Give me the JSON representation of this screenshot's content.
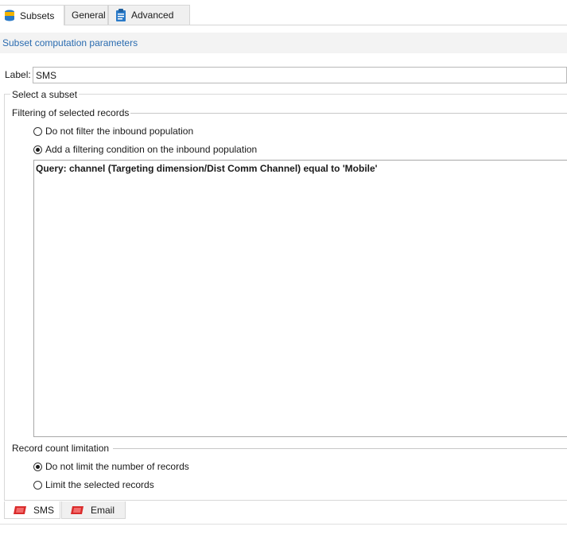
{
  "tabs": [
    {
      "label": "Subsets",
      "icon": "database-icon",
      "active": true
    },
    {
      "label": "General",
      "icon": "",
      "active": false
    },
    {
      "label": "Advanced",
      "icon": "clipboard-icon",
      "active": false
    }
  ],
  "section_title": "Subset computation parameters",
  "label_field": {
    "label": "Label:",
    "value": "SMS"
  },
  "select_subset": {
    "legend": "Select a subset",
    "filtering": {
      "legend": "Filtering of selected records",
      "options": [
        {
          "label": "Do not filter the inbound population",
          "checked": false
        },
        {
          "label": "Add a filtering condition on the inbound population",
          "checked": true
        }
      ],
      "query": "Query: channel (Targeting dimension/Dist Comm Channel) equal to 'Mobile'"
    },
    "count_limit": {
      "legend": "Record count limitation",
      "options": [
        {
          "label": "Do not limit the number of records",
          "checked": true
        },
        {
          "label": "Limit the selected records",
          "checked": false
        }
      ]
    }
  },
  "bottom_tabs": [
    {
      "label": "SMS",
      "icon": "message-icon",
      "active": true
    },
    {
      "label": "Email",
      "icon": "message-icon",
      "active": false
    }
  ],
  "colors": {
    "accent": "#2b6cb0",
    "icon_red": "#d92b2b",
    "icon_blue": "#2a7ac8"
  }
}
